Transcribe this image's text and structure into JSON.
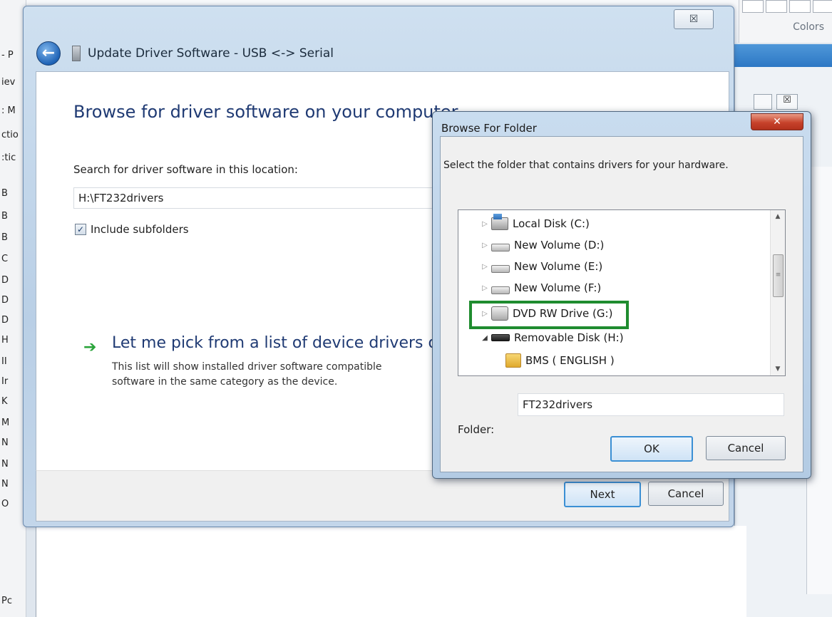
{
  "wizard": {
    "close_label": "☒",
    "title": "Update Driver Software - USB <-> Serial",
    "heading": "Browse for driver software on your computer",
    "search_label": "Search for driver software in this location:",
    "path_value": "H:\\FT232drivers",
    "include_subfolders_label": "Include subfolders",
    "include_subfolders_checked": true,
    "pick_title": "Let me pick from a list of device drivers o",
    "pick_desc_line1": "This list will show installed driver software compatible",
    "pick_desc_line2": "software in the same category as the device.",
    "next_label": "Next",
    "cancel_label": "Cancel"
  },
  "browse_dialog": {
    "title": "Browse For Folder",
    "instruction": "Select the folder that contains drivers for your hardware.",
    "tree": [
      {
        "label": "Local Disk (C:)",
        "icon": "local-disk-icon",
        "expanded": false,
        "highlighted": false
      },
      {
        "label": "New Volume (D:)",
        "icon": "volume-icon",
        "expanded": false,
        "highlighted": false
      },
      {
        "label": "New Volume (E:)",
        "icon": "volume-icon",
        "expanded": false,
        "highlighted": false
      },
      {
        "label": "New Volume (F:)",
        "icon": "volume-icon",
        "expanded": false,
        "highlighted": false
      },
      {
        "label": "DVD RW Drive (G:)",
        "icon": "dvd-drive-icon",
        "expanded": false,
        "highlighted": true
      },
      {
        "label": "Removable Disk (H:)",
        "icon": "removable-disk-icon",
        "expanded": true,
        "highlighted": false
      },
      {
        "label": "BMS ( ENGLISH )",
        "icon": "folder-icon",
        "expanded": false,
        "highlighted": false
      }
    ],
    "folder_label": "Folder:",
    "folder_value": "FT232drivers",
    "ok_label": "OK",
    "cancel_label": "Cancel",
    "highlight_color": "#1f8c2f"
  },
  "background": {
    "colors_label": "Colors",
    "left_strip_rows": [
      "- P",
      "iev",
      ": M",
      "ctio",
      ":tic",
      "B",
      "B",
      "B",
      "C",
      "D",
      "D",
      "D",
      "H",
      "II",
      "Ir",
      "K",
      "M",
      "N",
      "N",
      "N",
      "O",
      "Pc"
    ]
  }
}
